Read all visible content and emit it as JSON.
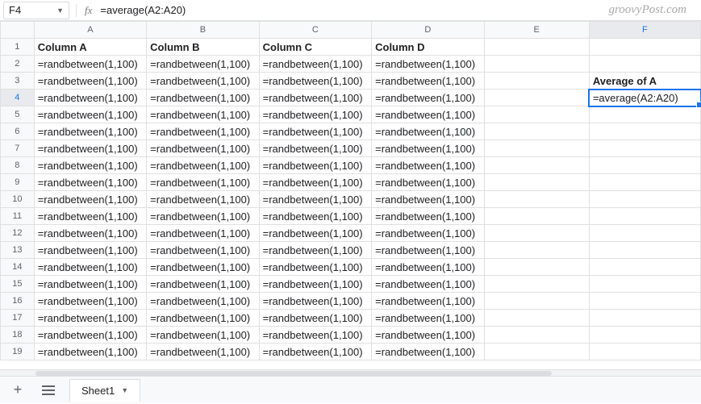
{
  "name_box": "F4",
  "formula": "=average(A2:A20)",
  "watermark": "groovyPost.com",
  "columns": [
    "A",
    "B",
    "C",
    "D",
    "E",
    "F"
  ],
  "selected_col": "F",
  "selected_row": 4,
  "rows": 19,
  "randformula": "=randbetween(1,100)",
  "header_row": {
    "A": "Column A",
    "B": "Column B",
    "C": "Column C",
    "D": "Column D"
  },
  "f3_label": "Average of A",
  "f4_value": "=average(A2:A20)",
  "sheet_tab": "Sheet1"
}
